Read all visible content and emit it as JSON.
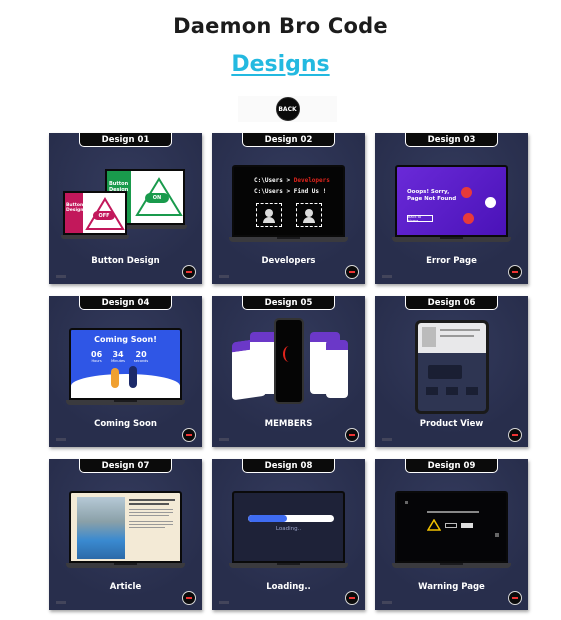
{
  "header": {
    "site_title": "Daemon Bro Code",
    "section_link": "Designs",
    "back_label": "BACK"
  },
  "designs": [
    {
      "tag": "Design 01",
      "caption": "Button Design",
      "screen": {
        "panel_a_title": "Button Design",
        "panel_b_title": "Button Design",
        "toggle_on": "ON",
        "toggle_off": "OFF"
      }
    },
    {
      "tag": "Design 02",
      "caption": "Developers",
      "screen": {
        "line1_prefix": "C:\\Users > ",
        "line1_highlight": "Developers",
        "line2": "C:\\Users > Find Us !"
      }
    },
    {
      "tag": "Design 03",
      "caption": "Error Page",
      "screen": {
        "heading": "Ooops! Sorry, Page Not Found",
        "button": "Back to Home"
      }
    },
    {
      "tag": "Design 04",
      "caption": "Coming Soon",
      "screen": {
        "heading": "Coming Soon!",
        "countdown": [
          {
            "value": "06",
            "unit": "Hours"
          },
          {
            "value": "34",
            "unit": "Minutes"
          },
          {
            "value": "20",
            "unit": "seconds"
          }
        ]
      }
    },
    {
      "tag": "Design 05",
      "caption": "MEMBERS"
    },
    {
      "tag": "Design 06",
      "caption": "Product View"
    },
    {
      "tag": "Design 07",
      "caption": "Article"
    },
    {
      "tag": "Design 08",
      "caption": "Loading..",
      "screen": {
        "loading_text": "Loading..",
        "progress": 0.45
      }
    },
    {
      "tag": "Design 09",
      "caption": "Warning Page"
    }
  ],
  "colors": {
    "card_bg": "#282e4c",
    "link_accent": "#23b9e0",
    "error_bg": "#5a1fc7",
    "coming_soon_bg": "#2f56e6",
    "loading_bar": "#3f6cf2"
  }
}
